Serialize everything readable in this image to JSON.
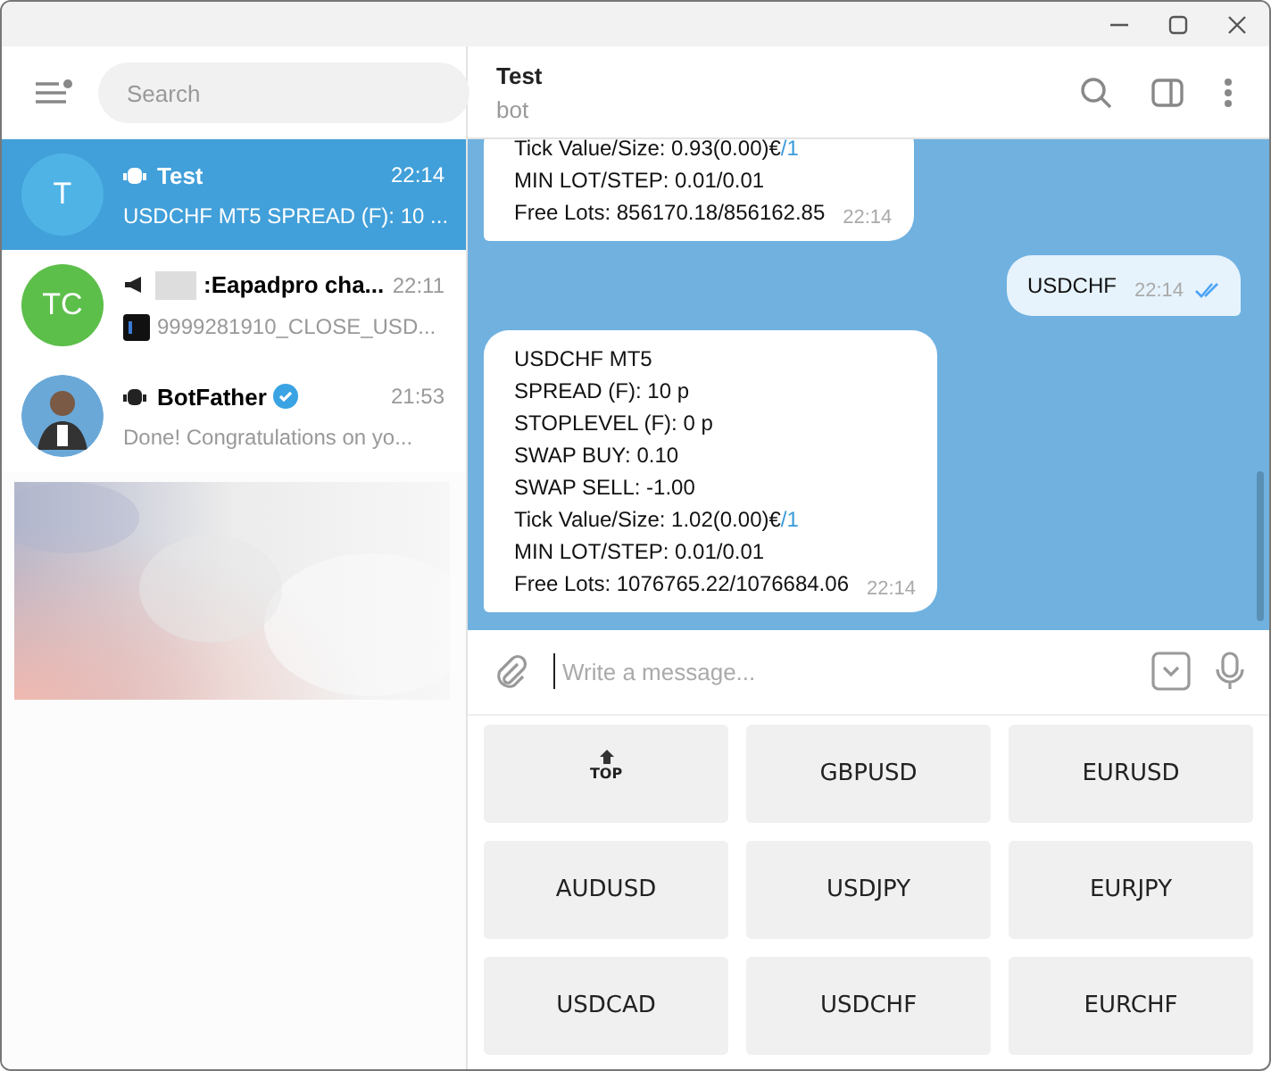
{
  "search": {
    "placeholder": "Search"
  },
  "chats": [
    {
      "kind": "bot",
      "initials": "T",
      "color": "#4fb3e6",
      "name": "Test",
      "time": "22:14",
      "preview": "USDCHF MT5 SPREAD (F): 10 ...",
      "selected": true,
      "verified": false,
      "redacted": false,
      "thumb": false
    },
    {
      "kind": "channel",
      "initials": "TC",
      "color": "#5cbf4a",
      "name": ":Eapadpro cha...",
      "time": "22:11",
      "preview": "9999281910_CLOSE_USD...",
      "selected": false,
      "verified": false,
      "redacted": true,
      "thumb": true
    },
    {
      "kind": "bot",
      "name": "BotFather",
      "time": "21:53",
      "preview": "Done! Congratulations on yo...",
      "selected": false,
      "verified": true,
      "redacted": false,
      "thumb": false
    }
  ],
  "header": {
    "title": "Test",
    "subtitle": "bot"
  },
  "messages": [
    {
      "kind": "incoming",
      "lines": [
        {
          "text": "Tick Value/Size: 0.93(0.00)€",
          "link": "/1"
        },
        {
          "text": "MIN LOT/STEP: 0.01/0.01"
        },
        {
          "text": "Free Lots: 856170.18/856162.85"
        }
      ],
      "time": "22:14"
    },
    {
      "kind": "outgoing",
      "lines": [
        {
          "text": "USDCHF"
        }
      ],
      "time": "22:14",
      "read": true
    },
    {
      "kind": "incoming",
      "lines": [
        {
          "text": "USDCHF MT5"
        },
        {
          "text": "SPREAD (F): 10 p"
        },
        {
          "text": "STOPLEVEL (F): 0 p"
        },
        {
          "text": "SWAP BUY: 0.10"
        },
        {
          "text": "SWAP SELL: -1.00"
        },
        {
          "text": "Tick Value/Size: 1.02(0.00)€",
          "link": "/1"
        },
        {
          "text": "MIN LOT/STEP: 0.01/0.01"
        },
        {
          "text": "Free Lots: 1076765.22/1076684.06"
        }
      ],
      "time": "22:14"
    }
  ],
  "composer": {
    "placeholder": "Write a message..."
  },
  "keyboard": [
    {
      "kind": "top",
      "label": "TOP"
    },
    {
      "kind": "text",
      "label": "GBPUSD"
    },
    {
      "kind": "text",
      "label": "EURUSD"
    },
    {
      "kind": "text",
      "label": "AUDUSD"
    },
    {
      "kind": "text",
      "label": "USDJPY"
    },
    {
      "kind": "text",
      "label": "EURJPY"
    },
    {
      "kind": "text",
      "label": "USDCAD"
    },
    {
      "kind": "text",
      "label": "USDCHF"
    },
    {
      "kind": "text",
      "label": "EURCHF"
    }
  ]
}
